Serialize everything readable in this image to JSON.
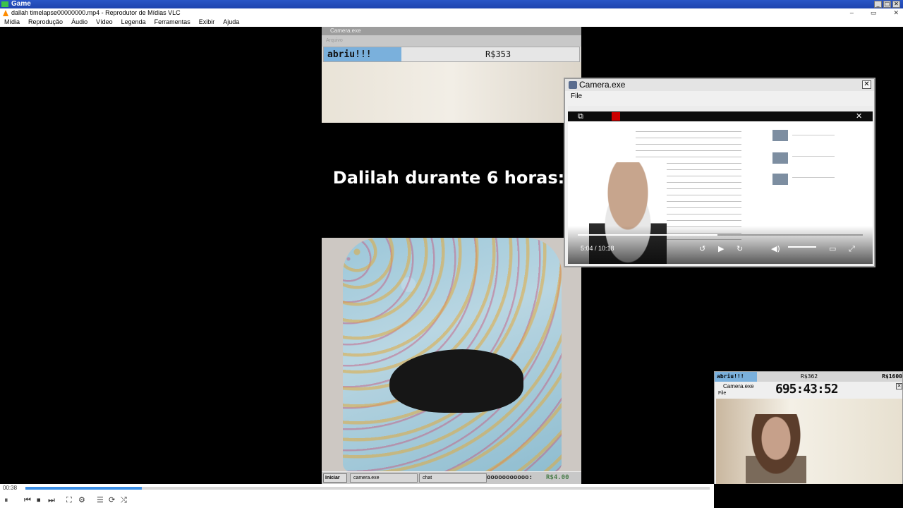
{
  "outer_window": {
    "title": "Game",
    "buttons": [
      "_",
      "□",
      "✕"
    ]
  },
  "vlc": {
    "title": "dallah timelapse00000000.mp4 - Reprodutor de Mídias VLC",
    "menu": [
      "Mídia",
      "Reprodução",
      "Áudio",
      "Vídeo",
      "Legenda",
      "Ferramentas",
      "Exibir",
      "Ajuda"
    ],
    "window_controls": [
      "–",
      "▭",
      "✕"
    ],
    "elapsed_time": "00:38",
    "seek_progress_fraction": 0.17
  },
  "center_camera_top": {
    "title": "Camera.exe",
    "menu": "Arquivo",
    "status_label": "abriu!!!",
    "money": "R$353"
  },
  "overlay_caption": "Dalilah durante 6 horas:",
  "center_taskbar": {
    "start": "Iniciar",
    "items": [
      "camera.exe",
      "chat"
    ],
    "counter": "ooooooooooo:",
    "money": "R$4.00"
  },
  "camera_window": {
    "title": "Camera.exe",
    "menu": "File",
    "video_time": "5:04 / 10:18",
    "video_progress_fraction": 0.49
  },
  "mini_camera": {
    "status_label": "abriu!!!",
    "money_mid": "R$362",
    "money_right": "R$1600",
    "title": "Camera.exe",
    "menu": "File",
    "timer": "695:43:52"
  },
  "icons": {
    "pause": "⏸",
    "prev": "⏮",
    "stop": "⏹",
    "next": "⏭",
    "fullscreen": "⛶",
    "ext_settings": "⚙",
    "playlist": "☰",
    "loop": "⟳",
    "shuffle": "⤮",
    "play": "▶",
    "volume": "🔊",
    "close": "✕"
  },
  "colors": {
    "vlc_blue": "#3a8ee6",
    "progress_fill": "#7ab0dc",
    "title_blue": "#1e44ae"
  }
}
